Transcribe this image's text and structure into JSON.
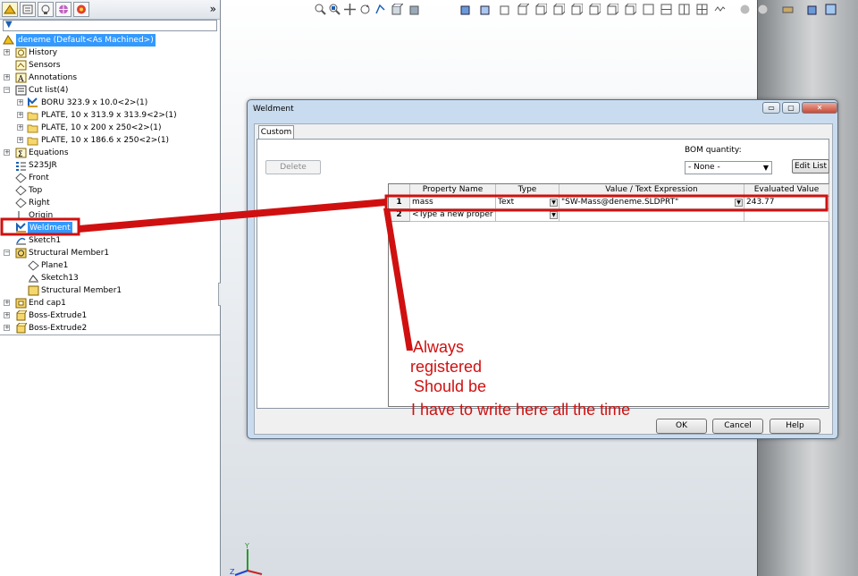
{
  "left_panel": {
    "tabs": [
      "feature-manager-icon",
      "property-manager-icon",
      "configuration-manager-icon",
      "dimxpert-icon",
      "display-manager-icon"
    ],
    "more_label": "»",
    "filter_icon": "filter-icon",
    "tree": [
      {
        "label": "deneme  (Default<As Machined>)",
        "icon": "part-icon",
        "selected": true
      },
      {
        "label": "History",
        "icon": "history-icon"
      },
      {
        "label": "Sensors",
        "icon": "sensor-icon"
      },
      {
        "label": "Annotations",
        "icon": "annotation-icon"
      },
      {
        "label": "Cut list(4)",
        "icon": "cutlist-icon"
      },
      {
        "label": "BORU 323.9 x 10.0<2>(1)",
        "icon": "weldment-item-icon"
      },
      {
        "label": "PLATE, 10 x 313.9 x 313.9<2>(1)",
        "icon": "folder-icon"
      },
      {
        "label": "PLATE, 10 x 200 x 250<2>(1)",
        "icon": "folder-icon"
      },
      {
        "label": "PLATE, 10 x 186.6 x 250<2>(1)",
        "icon": "folder-icon"
      },
      {
        "label": "Equations",
        "icon": "equations-icon"
      },
      {
        "label": "S235JR",
        "icon": "material-icon"
      },
      {
        "label": "Front",
        "icon": "plane-icon"
      },
      {
        "label": "Top",
        "icon": "plane-icon"
      },
      {
        "label": "Right",
        "icon": "plane-icon"
      },
      {
        "label": "Origin",
        "icon": "origin-icon"
      },
      {
        "label": "Weldment",
        "icon": "weldment-icon",
        "selected": true
      },
      {
        "label": "Sketch1",
        "icon": "sketch-icon"
      },
      {
        "label": "Structural Member1",
        "icon": "structural-member-icon"
      },
      {
        "label": "Plane1",
        "icon": "plane-icon"
      },
      {
        "label": "Sketch13",
        "icon": "sketch-icon"
      },
      {
        "label": "Structural Member1",
        "icon": "folder-icon"
      },
      {
        "label": "End cap1",
        "icon": "end-cap-icon"
      },
      {
        "label": "Boss-Extrude1",
        "icon": "extrude-icon"
      },
      {
        "label": "Boss-Extrude2",
        "icon": "extrude-icon"
      }
    ]
  },
  "dialog": {
    "title": "Weldment",
    "window_buttons": {
      "minimize": "▭",
      "maximize": "▢",
      "close": "✕"
    },
    "tab_label": "Custom",
    "delete_label": "Delete",
    "bom_quantity_label": "BOM quantity:",
    "bom_quantity_value": "- None -",
    "edit_list_label": "Edit List",
    "table": {
      "headers": [
        "Property Name",
        "Type",
        "Value / Text Expression",
        "Evaluated Value"
      ],
      "rows": [
        {
          "num": "1",
          "name": "mass",
          "type": "Text",
          "value": "\"SW-Mass@deneme.SLDPRT\"",
          "evaluated": "243.77"
        },
        {
          "num": "2",
          "name": "<Type a new proper",
          "type": "",
          "value": "",
          "evaluated": ""
        }
      ]
    },
    "ok_label": "OK",
    "cancel_label": "Cancel",
    "help_label": "Help"
  },
  "annotations": {
    "color": "#d01010",
    "lines": [
      "Always",
      "registered",
      "Should be",
      "I have to write here all the time"
    ]
  },
  "colors": {
    "selection": "#3399ff",
    "dialog_frame": "#c9dcef",
    "annotation": "#d01010"
  }
}
